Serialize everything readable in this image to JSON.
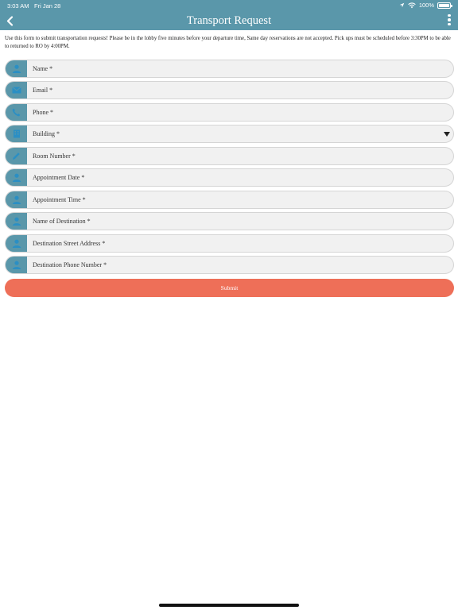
{
  "status_bar": {
    "time": "3:03 AM",
    "date": "Fri Jan 28",
    "battery": "100%"
  },
  "header": {
    "title": "Transport Request"
  },
  "intro": "Use this form to submit transportation requests! Please be in the lobby five minutes before your departure time, Same day reservations are not accepted. Pick ups must be scheduled before 3:30PM to be able to returned to RO by 4:00PM.",
  "form": {
    "fields": [
      {
        "label": "Name *",
        "icon": "person-icon"
      },
      {
        "label": "Email *",
        "icon": "envelope-icon"
      },
      {
        "label": "Phone *",
        "icon": "phone-icon"
      },
      {
        "label": "Building *",
        "icon": "building-icon",
        "type": "select"
      },
      {
        "label": "Room Number *",
        "icon": "pencil-icon"
      },
      {
        "label": "Appointment Date *",
        "icon": "person-icon"
      },
      {
        "label": "Appointment Time *",
        "icon": "person-icon"
      },
      {
        "label": "Name of Destination *",
        "icon": "person-icon"
      },
      {
        "label": "Destination Street Address *",
        "icon": "person-icon"
      },
      {
        "label": "Destination Phone Number *",
        "icon": "person-icon"
      }
    ],
    "submit_label": "Submit"
  },
  "colors": {
    "header": "#5a97aa",
    "icon_tile": "#5a97aa",
    "icon_glyph": "#2b8fc4",
    "submit": "#ee6f58",
    "field_bg": "#f1f1f1"
  }
}
